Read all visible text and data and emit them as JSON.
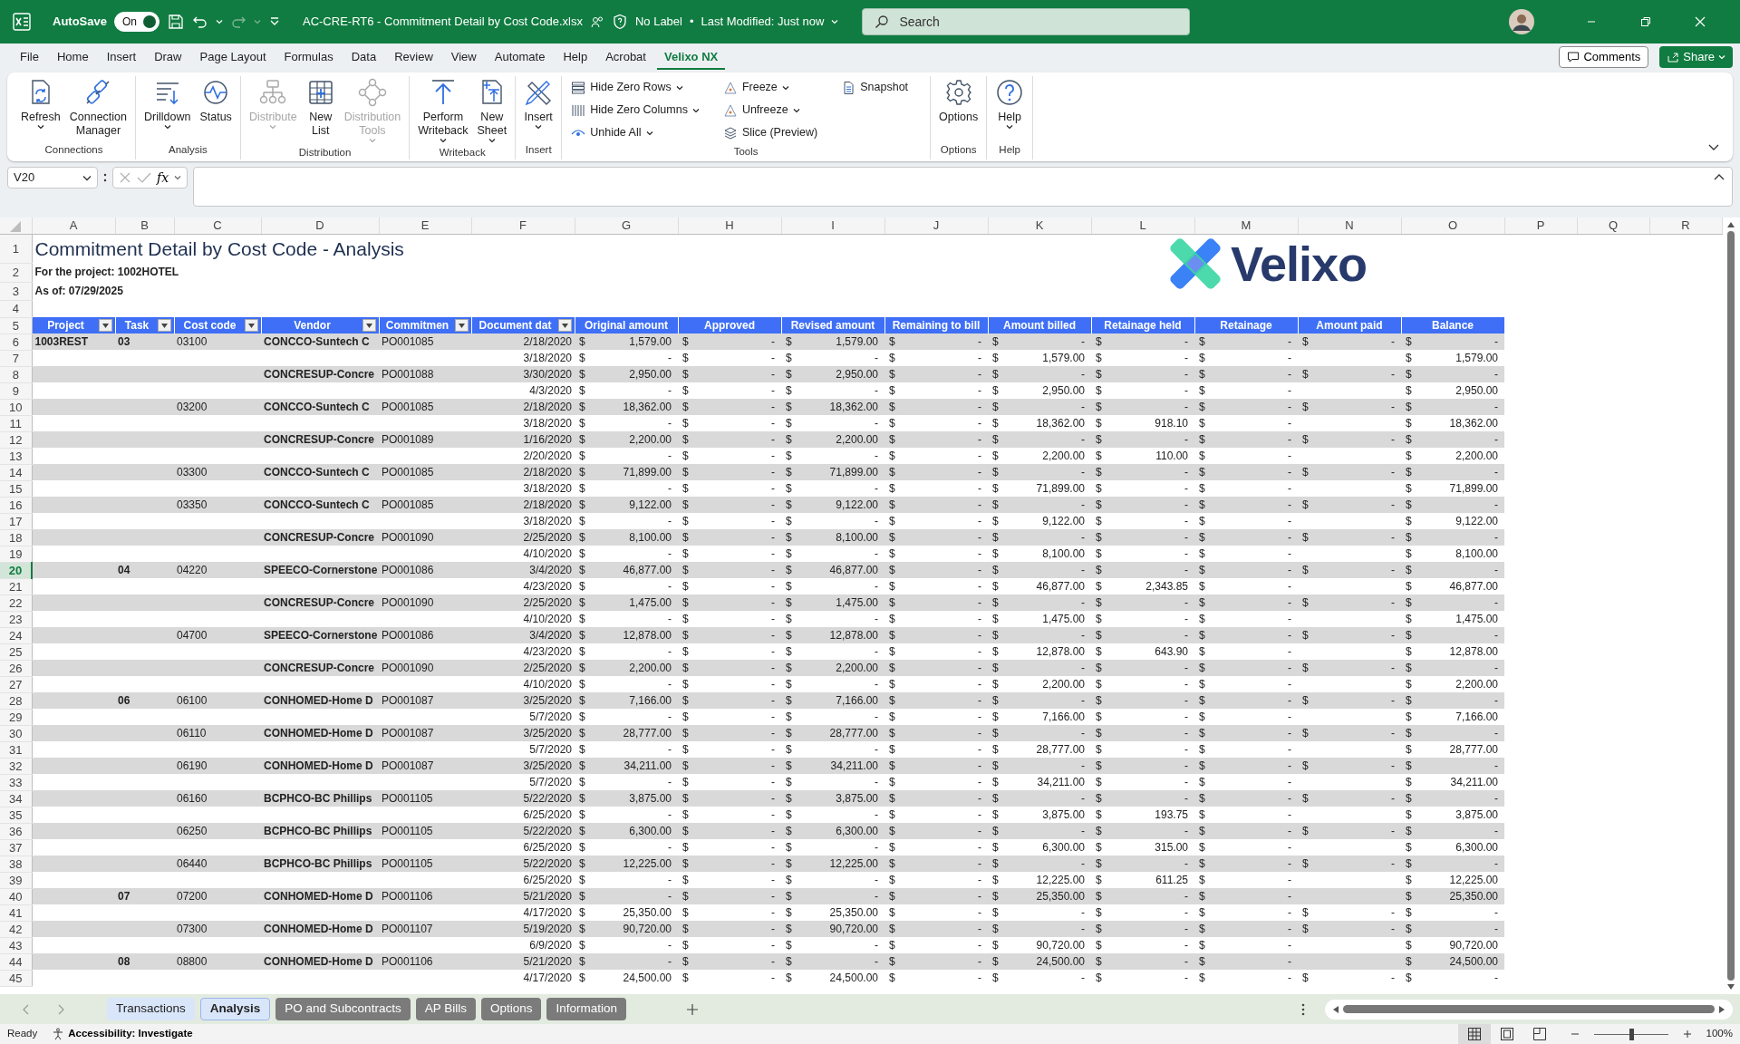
{
  "titlebar": {
    "autosave_label": "AutoSave",
    "autosave_toggle": {
      "label": "On",
      "on": true
    },
    "filename": "AC-CRE-RT6 - Commitment Detail by Cost Code.xlsx",
    "sensitivity": "No Label",
    "separator": "•",
    "modified": "Last Modified: Just now",
    "search": {
      "placeholder": "Search"
    }
  },
  "menu": {
    "tabs": [
      {
        "label": "File",
        "selected": false
      },
      {
        "label": "Home",
        "selected": false
      },
      {
        "label": "Insert",
        "selected": false
      },
      {
        "label": "Draw",
        "selected": false
      },
      {
        "label": "Page Layout",
        "selected": false
      },
      {
        "label": "Formulas",
        "selected": false
      },
      {
        "label": "Data",
        "selected": false
      },
      {
        "label": "Review",
        "selected": false
      },
      {
        "label": "View",
        "selected": false
      },
      {
        "label": "Automate",
        "selected": false
      },
      {
        "label": "Help",
        "selected": false
      },
      {
        "label": "Acrobat",
        "selected": false
      },
      {
        "label": "Velixo NX",
        "selected": true
      }
    ],
    "comments": "Comments",
    "share": "Share"
  },
  "ribbon": {
    "groups": [
      {
        "label": "Connections",
        "buttons": [
          {
            "kind": "large",
            "label": "Refresh",
            "menu": true,
            "disabled": false
          },
          {
            "kind": "large",
            "label": "Connection Manager",
            "menu": false,
            "disabled": false
          }
        ]
      },
      {
        "label": "Analysis",
        "buttons": [
          {
            "kind": "large",
            "label": "Drilldown",
            "menu": true,
            "disabled": false
          },
          {
            "kind": "large",
            "label": "Status",
            "menu": false,
            "disabled": false
          }
        ]
      },
      {
        "label": "Distribution",
        "buttons": [
          {
            "kind": "large",
            "label": "Distribute",
            "menu": true,
            "disabled": true
          },
          {
            "kind": "large",
            "label": "New List",
            "menu": false,
            "disabled": false
          },
          {
            "kind": "large",
            "label": "Distribution Tools",
            "menu": true,
            "disabled": true
          }
        ]
      },
      {
        "label": "Writeback",
        "buttons": [
          {
            "kind": "large",
            "label": "Perform Writeback",
            "menu": true,
            "disabled": false
          },
          {
            "kind": "large",
            "label": "New Sheet",
            "menu": true,
            "disabled": false
          }
        ]
      },
      {
        "label": "Insert",
        "buttons": [
          {
            "kind": "large",
            "label": "Insert",
            "menu": true,
            "disabled": false
          }
        ]
      },
      {
        "label": "Tools",
        "buttons": [
          {
            "kind": "small",
            "label": "Hide Zero Rows",
            "menu": true,
            "disabled": false
          },
          {
            "kind": "small",
            "label": "Hide Zero Columns",
            "menu": true,
            "disabled": false
          },
          {
            "kind": "small",
            "label": "Unhide All",
            "menu": true,
            "disabled": false
          },
          {
            "kind": "small",
            "label": "Freeze",
            "menu": true,
            "disabled": false
          },
          {
            "kind": "small",
            "label": "Unfreeze",
            "menu": true,
            "disabled": false
          },
          {
            "kind": "small",
            "label": "Slice (Preview)",
            "menu": false,
            "disabled": false
          },
          {
            "kind": "small",
            "label": "Snapshot",
            "menu": false,
            "disabled": false
          }
        ]
      },
      {
        "label": "Options",
        "buttons": [
          {
            "kind": "large",
            "label": "Options",
            "menu": false,
            "disabled": false
          }
        ]
      },
      {
        "label": "Help",
        "buttons": [
          {
            "kind": "large",
            "label": "Help",
            "menu": true,
            "disabled": false
          }
        ]
      }
    ]
  },
  "formula_bar": {
    "name_box": "V20",
    "function_button": "fx"
  },
  "sheet": {
    "columns": [
      "A",
      "B",
      "C",
      "D",
      "E",
      "F",
      "G",
      "H",
      "I",
      "J",
      "K",
      "L",
      "M",
      "N",
      "O",
      "P",
      "Q",
      "R"
    ],
    "title": "Commitment Detail by Cost Code - Analysis",
    "project_line": "For the project: 1002HOTEL",
    "as_of_line": "As of: 07/29/2025",
    "logo_text": "Velixo",
    "top_rows": [
      "1",
      "2",
      "3",
      "4",
      "5"
    ],
    "headers": [
      {
        "label": "Project",
        "filter": true
      },
      {
        "label": "Task",
        "filter": true
      },
      {
        "label": "Cost code",
        "filter": true
      },
      {
        "label": "Vendor",
        "filter": true
      },
      {
        "label": "Commitmen",
        "filter": true
      },
      {
        "label": "Document dat",
        "filter": true
      },
      {
        "label": "Original amount",
        "filter": false
      },
      {
        "label": "Approved",
        "filter": false
      },
      {
        "label": "Revised amount",
        "filter": false
      },
      {
        "label": "Remaining to bill",
        "filter": false
      },
      {
        "label": "Amount billed",
        "filter": false
      },
      {
        "label": "Retainage held",
        "filter": false
      },
      {
        "label": "Retainage",
        "filter": false
      },
      {
        "label": "Amount paid",
        "filter": false
      },
      {
        "label": "Balance",
        "filter": false
      }
    ],
    "rows": [
      {
        "n": "6",
        "selected": false,
        "cells": [
          "1003REST",
          "03",
          "03100",
          "CONCCO-Suntech C",
          "PO001085",
          "2/18/2020",
          [
            "$",
            "1,579.00"
          ],
          [
            "$",
            "-"
          ],
          [
            "$",
            "1,579.00"
          ],
          [
            "$",
            "-"
          ],
          [
            "$",
            "-"
          ],
          [
            "$",
            "-"
          ],
          [
            "$",
            "-"
          ],
          [
            "$",
            "-"
          ],
          [
            "$",
            "-"
          ]
        ]
      },
      {
        "n": "7",
        "selected": false,
        "cells": [
          null,
          null,
          null,
          null,
          null,
          "3/18/2020",
          [
            "$",
            "-"
          ],
          [
            "$",
            "-"
          ],
          [
            "$",
            "-"
          ],
          [
            "$",
            "-"
          ],
          [
            "$",
            "1,579.00"
          ],
          [
            "$",
            "-"
          ],
          [
            "$",
            "-"
          ],
          null,
          [
            "$",
            "1,579.00"
          ]
        ]
      },
      {
        "n": "8",
        "selected": false,
        "cells": [
          null,
          null,
          null,
          "CONCRESUP-Concre",
          "PO001088",
          "3/30/2020",
          [
            "$",
            "2,950.00"
          ],
          [
            "$",
            "-"
          ],
          [
            "$",
            "2,950.00"
          ],
          [
            "$",
            "-"
          ],
          [
            "$",
            "-"
          ],
          [
            "$",
            "-"
          ],
          [
            "$",
            "-"
          ],
          [
            "$",
            "-"
          ],
          [
            "$",
            "-"
          ]
        ]
      },
      {
        "n": "9",
        "selected": false,
        "cells": [
          null,
          null,
          null,
          null,
          null,
          "4/3/2020",
          [
            "$",
            "-"
          ],
          [
            "$",
            "-"
          ],
          [
            "$",
            "-"
          ],
          [
            "$",
            "-"
          ],
          [
            "$",
            "2,950.00"
          ],
          [
            "$",
            "-"
          ],
          [
            "$",
            "-"
          ],
          null,
          [
            "$",
            "2,950.00"
          ]
        ]
      },
      {
        "n": "10",
        "selected": false,
        "cells": [
          null,
          null,
          "03200",
          "CONCCO-Suntech C",
          "PO001085",
          "2/18/2020",
          [
            "$",
            "18,362.00"
          ],
          [
            "$",
            "-"
          ],
          [
            "$",
            "18,362.00"
          ],
          [
            "$",
            "-"
          ],
          [
            "$",
            "-"
          ],
          [
            "$",
            "-"
          ],
          [
            "$",
            "-"
          ],
          [
            "$",
            "-"
          ],
          [
            "$",
            "-"
          ]
        ]
      },
      {
        "n": "11",
        "selected": false,
        "cells": [
          null,
          null,
          null,
          null,
          null,
          "3/18/2020",
          [
            "$",
            "-"
          ],
          [
            "$",
            "-"
          ],
          [
            "$",
            "-"
          ],
          [
            "$",
            "-"
          ],
          [
            "$",
            "18,362.00"
          ],
          [
            "$",
            "918.10"
          ],
          [
            "$",
            "-"
          ],
          null,
          [
            "$",
            "18,362.00"
          ]
        ]
      },
      {
        "n": "12",
        "selected": false,
        "cells": [
          null,
          null,
          null,
          "CONCRESUP-Concre",
          "PO001089",
          "1/16/2020",
          [
            "$",
            "2,200.00"
          ],
          [
            "$",
            "-"
          ],
          [
            "$",
            "2,200.00"
          ],
          [
            "$",
            "-"
          ],
          [
            "$",
            "-"
          ],
          [
            "$",
            "-"
          ],
          [
            "$",
            "-"
          ],
          [
            "$",
            "-"
          ],
          [
            "$",
            "-"
          ]
        ]
      },
      {
        "n": "13",
        "selected": false,
        "cells": [
          null,
          null,
          null,
          null,
          null,
          "2/20/2020",
          [
            "$",
            "-"
          ],
          [
            "$",
            "-"
          ],
          [
            "$",
            "-"
          ],
          [
            "$",
            "-"
          ],
          [
            "$",
            "2,200.00"
          ],
          [
            "$",
            "110.00"
          ],
          [
            "$",
            "-"
          ],
          null,
          [
            "$",
            "2,200.00"
          ]
        ]
      },
      {
        "n": "14",
        "selected": false,
        "cells": [
          null,
          null,
          "03300",
          "CONCCO-Suntech C",
          "PO001085",
          "2/18/2020",
          [
            "$",
            "71,899.00"
          ],
          [
            "$",
            "-"
          ],
          [
            "$",
            "71,899.00"
          ],
          [
            "$",
            "-"
          ],
          [
            "$",
            "-"
          ],
          [
            "$",
            "-"
          ],
          [
            "$",
            "-"
          ],
          [
            "$",
            "-"
          ],
          [
            "$",
            "-"
          ]
        ]
      },
      {
        "n": "15",
        "selected": false,
        "cells": [
          null,
          null,
          null,
          null,
          null,
          "3/18/2020",
          [
            "$",
            "-"
          ],
          [
            "$",
            "-"
          ],
          [
            "$",
            "-"
          ],
          [
            "$",
            "-"
          ],
          [
            "$",
            "71,899.00"
          ],
          [
            "$",
            "-"
          ],
          [
            "$",
            "-"
          ],
          null,
          [
            "$",
            "71,899.00"
          ]
        ]
      },
      {
        "n": "16",
        "selected": false,
        "cells": [
          null,
          null,
          "03350",
          "CONCCO-Suntech C",
          "PO001085",
          "2/18/2020",
          [
            "$",
            "9,122.00"
          ],
          [
            "$",
            "-"
          ],
          [
            "$",
            "9,122.00"
          ],
          [
            "$",
            "-"
          ],
          [
            "$",
            "-"
          ],
          [
            "$",
            "-"
          ],
          [
            "$",
            "-"
          ],
          [
            "$",
            "-"
          ],
          [
            "$",
            "-"
          ]
        ]
      },
      {
        "n": "17",
        "selected": false,
        "cells": [
          null,
          null,
          null,
          null,
          null,
          "3/18/2020",
          [
            "$",
            "-"
          ],
          [
            "$",
            "-"
          ],
          [
            "$",
            "-"
          ],
          [
            "$",
            "-"
          ],
          [
            "$",
            "9,122.00"
          ],
          [
            "$",
            "-"
          ],
          [
            "$",
            "-"
          ],
          null,
          [
            "$",
            "9,122.00"
          ]
        ]
      },
      {
        "n": "18",
        "selected": false,
        "cells": [
          null,
          null,
          null,
          "CONCRESUP-Concre",
          "PO001090",
          "2/25/2020",
          [
            "$",
            "8,100.00"
          ],
          [
            "$",
            "-"
          ],
          [
            "$",
            "8,100.00"
          ],
          [
            "$",
            "-"
          ],
          [
            "$",
            "-"
          ],
          [
            "$",
            "-"
          ],
          [
            "$",
            "-"
          ],
          [
            "$",
            "-"
          ],
          [
            "$",
            "-"
          ]
        ]
      },
      {
        "n": "19",
        "selected": false,
        "cells": [
          null,
          null,
          null,
          null,
          null,
          "4/10/2020",
          [
            "$",
            "-"
          ],
          [
            "$",
            "-"
          ],
          [
            "$",
            "-"
          ],
          [
            "$",
            "-"
          ],
          [
            "$",
            "8,100.00"
          ],
          [
            "$",
            "-"
          ],
          [
            "$",
            "-"
          ],
          null,
          [
            "$",
            "8,100.00"
          ]
        ]
      },
      {
        "n": "20",
        "selected": true,
        "cells": [
          null,
          "04",
          "04220",
          "SPEECO-Cornerstone",
          "PO001086",
          "3/4/2020",
          [
            "$",
            "46,877.00"
          ],
          [
            "$",
            "-"
          ],
          [
            "$",
            "46,877.00"
          ],
          [
            "$",
            "-"
          ],
          [
            "$",
            "-"
          ],
          [
            "$",
            "-"
          ],
          [
            "$",
            "-"
          ],
          [
            "$",
            "-"
          ],
          [
            "$",
            "-"
          ]
        ]
      },
      {
        "n": "21",
        "selected": false,
        "cells": [
          null,
          null,
          null,
          null,
          null,
          "4/23/2020",
          [
            "$",
            "-"
          ],
          [
            "$",
            "-"
          ],
          [
            "$",
            "-"
          ],
          [
            "$",
            "-"
          ],
          [
            "$",
            "46,877.00"
          ],
          [
            "$",
            "2,343.85"
          ],
          [
            "$",
            "-"
          ],
          null,
          [
            "$",
            "46,877.00"
          ]
        ]
      },
      {
        "n": "22",
        "selected": false,
        "cells": [
          null,
          null,
          null,
          "CONCRESUP-Concre",
          "PO001090",
          "2/25/2020",
          [
            "$",
            "1,475.00"
          ],
          [
            "$",
            "-"
          ],
          [
            "$",
            "1,475.00"
          ],
          [
            "$",
            "-"
          ],
          [
            "$",
            "-"
          ],
          [
            "$",
            "-"
          ],
          [
            "$",
            "-"
          ],
          [
            "$",
            "-"
          ],
          [
            "$",
            "-"
          ]
        ]
      },
      {
        "n": "23",
        "selected": false,
        "cells": [
          null,
          null,
          null,
          null,
          null,
          "4/10/2020",
          [
            "$",
            "-"
          ],
          [
            "$",
            "-"
          ],
          [
            "$",
            "-"
          ],
          [
            "$",
            "-"
          ],
          [
            "$",
            "1,475.00"
          ],
          [
            "$",
            "-"
          ],
          [
            "$",
            "-"
          ],
          null,
          [
            "$",
            "1,475.00"
          ]
        ]
      },
      {
        "n": "24",
        "selected": false,
        "cells": [
          null,
          null,
          "04700",
          "SPEECO-Cornerstone",
          "PO001086",
          "3/4/2020",
          [
            "$",
            "12,878.00"
          ],
          [
            "$",
            "-"
          ],
          [
            "$",
            "12,878.00"
          ],
          [
            "$",
            "-"
          ],
          [
            "$",
            "-"
          ],
          [
            "$",
            "-"
          ],
          [
            "$",
            "-"
          ],
          [
            "$",
            "-"
          ],
          [
            "$",
            "-"
          ]
        ]
      },
      {
        "n": "25",
        "selected": false,
        "cells": [
          null,
          null,
          null,
          null,
          null,
          "4/23/2020",
          [
            "$",
            "-"
          ],
          [
            "$",
            "-"
          ],
          [
            "$",
            "-"
          ],
          [
            "$",
            "-"
          ],
          [
            "$",
            "12,878.00"
          ],
          [
            "$",
            "643.90"
          ],
          [
            "$",
            "-"
          ],
          null,
          [
            "$",
            "12,878.00"
          ]
        ]
      },
      {
        "n": "26",
        "selected": false,
        "cells": [
          null,
          null,
          null,
          "CONCRESUP-Concre",
          "PO001090",
          "2/25/2020",
          [
            "$",
            "2,200.00"
          ],
          [
            "$",
            "-"
          ],
          [
            "$",
            "2,200.00"
          ],
          [
            "$",
            "-"
          ],
          [
            "$",
            "-"
          ],
          [
            "$",
            "-"
          ],
          [
            "$",
            "-"
          ],
          [
            "$",
            "-"
          ],
          [
            "$",
            "-"
          ]
        ]
      },
      {
        "n": "27",
        "selected": false,
        "cells": [
          null,
          null,
          null,
          null,
          null,
          "4/10/2020",
          [
            "$",
            "-"
          ],
          [
            "$",
            "-"
          ],
          [
            "$",
            "-"
          ],
          [
            "$",
            "-"
          ],
          [
            "$",
            "2,200.00"
          ],
          [
            "$",
            "-"
          ],
          [
            "$",
            "-"
          ],
          null,
          [
            "$",
            "2,200.00"
          ]
        ]
      },
      {
        "n": "28",
        "selected": false,
        "cells": [
          null,
          "06",
          "06100",
          "CONHOMED-Home D",
          "PO001087",
          "3/25/2020",
          [
            "$",
            "7,166.00"
          ],
          [
            "$",
            "-"
          ],
          [
            "$",
            "7,166.00"
          ],
          [
            "$",
            "-"
          ],
          [
            "$",
            "-"
          ],
          [
            "$",
            "-"
          ],
          [
            "$",
            "-"
          ],
          [
            "$",
            "-"
          ],
          [
            "$",
            "-"
          ]
        ]
      },
      {
        "n": "29",
        "selected": false,
        "cells": [
          null,
          null,
          null,
          null,
          null,
          "5/7/2020",
          [
            "$",
            "-"
          ],
          [
            "$",
            "-"
          ],
          [
            "$",
            "-"
          ],
          [
            "$",
            "-"
          ],
          [
            "$",
            "7,166.00"
          ],
          [
            "$",
            "-"
          ],
          [
            "$",
            "-"
          ],
          null,
          [
            "$",
            "7,166.00"
          ]
        ]
      },
      {
        "n": "30",
        "selected": false,
        "cells": [
          null,
          null,
          "06110",
          "CONHOMED-Home D",
          "PO001087",
          "3/25/2020",
          [
            "$",
            "28,777.00"
          ],
          [
            "$",
            "-"
          ],
          [
            "$",
            "28,777.00"
          ],
          [
            "$",
            "-"
          ],
          [
            "$",
            "-"
          ],
          [
            "$",
            "-"
          ],
          [
            "$",
            "-"
          ],
          [
            "$",
            "-"
          ],
          [
            "$",
            "-"
          ]
        ]
      },
      {
        "n": "31",
        "selected": false,
        "cells": [
          null,
          null,
          null,
          null,
          null,
          "5/7/2020",
          [
            "$",
            "-"
          ],
          [
            "$",
            "-"
          ],
          [
            "$",
            "-"
          ],
          [
            "$",
            "-"
          ],
          [
            "$",
            "28,777.00"
          ],
          [
            "$",
            "-"
          ],
          [
            "$",
            "-"
          ],
          null,
          [
            "$",
            "28,777.00"
          ]
        ]
      },
      {
        "n": "32",
        "selected": false,
        "cells": [
          null,
          null,
          "06190",
          "CONHOMED-Home D",
          "PO001087",
          "3/25/2020",
          [
            "$",
            "34,211.00"
          ],
          [
            "$",
            "-"
          ],
          [
            "$",
            "34,211.00"
          ],
          [
            "$",
            "-"
          ],
          [
            "$",
            "-"
          ],
          [
            "$",
            "-"
          ],
          [
            "$",
            "-"
          ],
          [
            "$",
            "-"
          ],
          [
            "$",
            "-"
          ]
        ]
      },
      {
        "n": "33",
        "selected": false,
        "cells": [
          null,
          null,
          null,
          null,
          null,
          "5/7/2020",
          [
            "$",
            "-"
          ],
          [
            "$",
            "-"
          ],
          [
            "$",
            "-"
          ],
          [
            "$",
            "-"
          ],
          [
            "$",
            "34,211.00"
          ],
          [
            "$",
            "-"
          ],
          [
            "$",
            "-"
          ],
          null,
          [
            "$",
            "34,211.00"
          ]
        ]
      },
      {
        "n": "34",
        "selected": false,
        "cells": [
          null,
          null,
          "06160",
          "BCPHCO-BC Phillips",
          "PO001105",
          "5/22/2020",
          [
            "$",
            "3,875.00"
          ],
          [
            "$",
            "-"
          ],
          [
            "$",
            "3,875.00"
          ],
          [
            "$",
            "-"
          ],
          [
            "$",
            "-"
          ],
          [
            "$",
            "-"
          ],
          [
            "$",
            "-"
          ],
          [
            "$",
            "-"
          ],
          [
            "$",
            "-"
          ]
        ]
      },
      {
        "n": "35",
        "selected": false,
        "cells": [
          null,
          null,
          null,
          null,
          null,
          "6/25/2020",
          [
            "$",
            "-"
          ],
          [
            "$",
            "-"
          ],
          [
            "$",
            "-"
          ],
          [
            "$",
            "-"
          ],
          [
            "$",
            "3,875.00"
          ],
          [
            "$",
            "193.75"
          ],
          [
            "$",
            "-"
          ],
          null,
          [
            "$",
            "3,875.00"
          ]
        ]
      },
      {
        "n": "36",
        "selected": false,
        "cells": [
          null,
          null,
          "06250",
          "BCPHCO-BC Phillips",
          "PO001105",
          "5/22/2020",
          [
            "$",
            "6,300.00"
          ],
          [
            "$",
            "-"
          ],
          [
            "$",
            "6,300.00"
          ],
          [
            "$",
            "-"
          ],
          [
            "$",
            "-"
          ],
          [
            "$",
            "-"
          ],
          [
            "$",
            "-"
          ],
          [
            "$",
            "-"
          ],
          [
            "$",
            "-"
          ]
        ]
      },
      {
        "n": "37",
        "selected": false,
        "cells": [
          null,
          null,
          null,
          null,
          null,
          "6/25/2020",
          [
            "$",
            "-"
          ],
          [
            "$",
            "-"
          ],
          [
            "$",
            "-"
          ],
          [
            "$",
            "-"
          ],
          [
            "$",
            "6,300.00"
          ],
          [
            "$",
            "315.00"
          ],
          [
            "$",
            "-"
          ],
          null,
          [
            "$",
            "6,300.00"
          ]
        ]
      },
      {
        "n": "38",
        "selected": false,
        "cells": [
          null,
          null,
          "06440",
          "BCPHCO-BC Phillips",
          "PO001105",
          "5/22/2020",
          [
            "$",
            "12,225.00"
          ],
          [
            "$",
            "-"
          ],
          [
            "$",
            "12,225.00"
          ],
          [
            "$",
            "-"
          ],
          [
            "$",
            "-"
          ],
          [
            "$",
            "-"
          ],
          [
            "$",
            "-"
          ],
          [
            "$",
            "-"
          ],
          [
            "$",
            "-"
          ]
        ]
      },
      {
        "n": "39",
        "selected": false,
        "cells": [
          null,
          null,
          null,
          null,
          null,
          "6/25/2020",
          [
            "$",
            "-"
          ],
          [
            "$",
            "-"
          ],
          [
            "$",
            "-"
          ],
          [
            "$",
            "-"
          ],
          [
            "$",
            "12,225.00"
          ],
          [
            "$",
            "611.25"
          ],
          [
            "$",
            "-"
          ],
          null,
          [
            "$",
            "12,225.00"
          ]
        ]
      },
      {
        "n": "40",
        "selected": false,
        "cells": [
          null,
          "07",
          "07200",
          "CONHOMED-Home D",
          "PO001106",
          "5/21/2020",
          [
            "$",
            "-"
          ],
          [
            "$",
            "-"
          ],
          [
            "$",
            "-"
          ],
          [
            "$",
            "-"
          ],
          [
            "$",
            "25,350.00"
          ],
          [
            "$",
            "-"
          ],
          [
            "$",
            "-"
          ],
          null,
          [
            "$",
            "25,350.00"
          ]
        ]
      },
      {
        "n": "41",
        "selected": false,
        "cells": [
          null,
          null,
          null,
          null,
          null,
          "4/17/2020",
          [
            "$",
            "25,350.00"
          ],
          [
            "$",
            "-"
          ],
          [
            "$",
            "25,350.00"
          ],
          [
            "$",
            "-"
          ],
          [
            "$",
            "-"
          ],
          [
            "$",
            "-"
          ],
          [
            "$",
            "-"
          ],
          [
            "$",
            "-"
          ],
          [
            "$",
            "-"
          ]
        ]
      },
      {
        "n": "42",
        "selected": false,
        "cells": [
          null,
          null,
          "07300",
          "CONHOMED-Home D",
          "PO001107",
          "5/19/2020",
          [
            "$",
            "90,720.00"
          ],
          [
            "$",
            "-"
          ],
          [
            "$",
            "90,720.00"
          ],
          [
            "$",
            "-"
          ],
          [
            "$",
            "-"
          ],
          [
            "$",
            "-"
          ],
          [
            "$",
            "-"
          ],
          [
            "$",
            "-"
          ],
          [
            "$",
            "-"
          ]
        ]
      },
      {
        "n": "43",
        "selected": false,
        "cells": [
          null,
          null,
          null,
          null,
          null,
          "6/9/2020",
          [
            "$",
            "-"
          ],
          [
            "$",
            "-"
          ],
          [
            "$",
            "-"
          ],
          [
            "$",
            "-"
          ],
          [
            "$",
            "90,720.00"
          ],
          [
            "$",
            "-"
          ],
          [
            "$",
            "-"
          ],
          null,
          [
            "$",
            "90,720.00"
          ]
        ]
      },
      {
        "n": "44",
        "selected": false,
        "cells": [
          null,
          "08",
          "08800",
          "CONHOMED-Home D",
          "PO001106",
          "5/21/2020",
          [
            "$",
            "-"
          ],
          [
            "$",
            "-"
          ],
          [
            "$",
            "-"
          ],
          [
            "$",
            "-"
          ],
          [
            "$",
            "24,500.00"
          ],
          [
            "$",
            "-"
          ],
          [
            "$",
            "-"
          ],
          null,
          [
            "$",
            "24,500.00"
          ]
        ]
      },
      {
        "n": "45",
        "selected": false,
        "cells": [
          null,
          null,
          null,
          null,
          null,
          "4/17/2020",
          [
            "$",
            "24,500.00"
          ],
          [
            "$",
            "-"
          ],
          [
            "$",
            "24,500.00"
          ],
          [
            "$",
            "-"
          ],
          [
            "$",
            "-"
          ],
          [
            "$",
            "-"
          ],
          [
            "$",
            "-"
          ],
          [
            "$",
            "-"
          ],
          [
            "$",
            "-"
          ]
        ]
      }
    ]
  },
  "sheet_tabs": [
    {
      "label": "Transactions",
      "selected": false,
      "color": "#d9e6fa"
    },
    {
      "label": "Analysis",
      "selected": true,
      "color": "#d9e6fa"
    },
    {
      "label": "PO and Subcontracts",
      "selected": false,
      "color": "#7b7b7b"
    },
    {
      "label": "AP Bills",
      "selected": false,
      "color": "#7b7b7b"
    },
    {
      "label": "Options",
      "selected": false,
      "color": "#7b7b7b"
    },
    {
      "label": "Information",
      "selected": false,
      "color": "#7b7b7b"
    }
  ],
  "status_bar": {
    "ready": "Ready",
    "accessibility": "Accessibility: Investigate",
    "views": [
      {
        "selected": true
      },
      {
        "selected": false
      },
      {
        "selected": false
      }
    ],
    "zoom_slider": {
      "level": 0.5
    },
    "zoom": "100%"
  }
}
